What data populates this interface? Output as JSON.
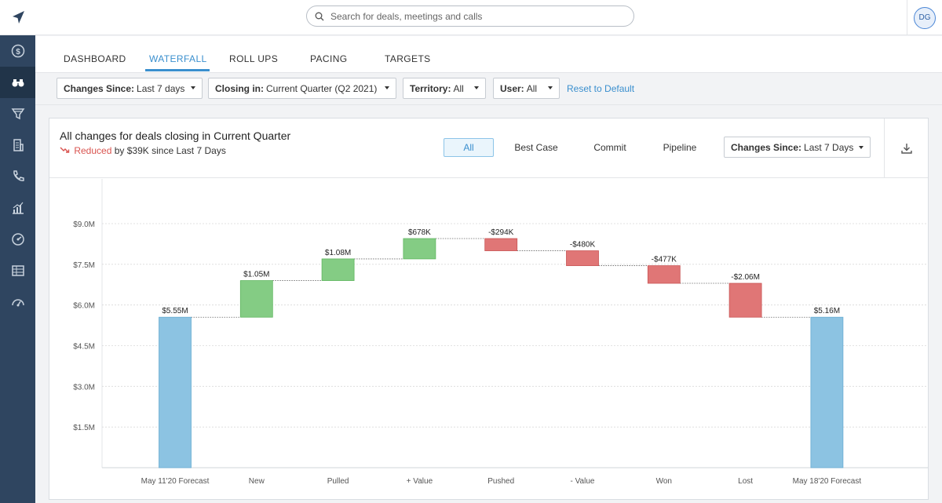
{
  "search": {
    "placeholder": "Search for deals, meetings and calls"
  },
  "user": {
    "initials": "DG"
  },
  "sidebar": {
    "items": [
      {
        "icon": "dollar-icon"
      },
      {
        "icon": "binoculars-icon",
        "active": true
      },
      {
        "icon": "funnel-icon"
      },
      {
        "icon": "building-icon"
      },
      {
        "icon": "phone-icon"
      },
      {
        "icon": "bar-chart-icon"
      },
      {
        "icon": "gauge-refresh-icon"
      },
      {
        "icon": "table-icon"
      },
      {
        "icon": "speedometer-icon"
      }
    ]
  },
  "tabs": [
    {
      "label": "DASHBOARD"
    },
    {
      "label": "WATERFALL",
      "active": true
    },
    {
      "label": "ROLL UPS"
    },
    {
      "label": "PACING"
    },
    {
      "label": "TARGETS"
    }
  ],
  "filters": {
    "changes_since": {
      "label": "Changes Since:",
      "value": "Last 7 days"
    },
    "closing_in": {
      "label": "Closing in:",
      "value": "Current Quarter (Q2 2021)"
    },
    "territory": {
      "label": "Territory:",
      "value": "All"
    },
    "user": {
      "label": "User:",
      "value": "All"
    },
    "reset": "Reset to Default"
  },
  "card": {
    "title": "All changes for deals closing in Current Quarter",
    "sub_change": "Reduced",
    "sub_rest": "by $39K since Last 7 Days",
    "segments": [
      "All",
      "Best Case",
      "Commit",
      "Pipeline"
    ],
    "active_segment": "All",
    "filter_label": "Changes Since:",
    "filter_value": "Last 7 Days"
  },
  "colors": {
    "total": "#8cc3e2",
    "increase": "#84cc84",
    "decrease": "#e07676",
    "accent": "#3a8fce",
    "sidebar": "#2f4560"
  },
  "chart_data": {
    "type": "bar",
    "subtype": "waterfall",
    "ylim": [
      0,
      9000000
    ],
    "yticks": [
      {
        "value": 1500000,
        "label": "$1.5M"
      },
      {
        "value": 3000000,
        "label": "$3.0M"
      },
      {
        "value": 4500000,
        "label": "$4.5M"
      },
      {
        "value": 6000000,
        "label": "$6.0M"
      },
      {
        "value": 7500000,
        "label": "$7.5M"
      },
      {
        "value": 9000000,
        "label": "$9.0M"
      }
    ],
    "grid": true,
    "bars": [
      {
        "category": "May 11'20 Forecast",
        "kind": "total",
        "start": 0,
        "end": 5550000,
        "label": "$5.55M"
      },
      {
        "category": "New",
        "kind": "increase",
        "start": 5550000,
        "end": 6900000,
        "label": "$1.05M"
      },
      {
        "category": "Pulled",
        "kind": "increase",
        "start": 6900000,
        "end": 7700000,
        "label": "$1.08M"
      },
      {
        "category": "+ Value",
        "kind": "increase",
        "start": 7700000,
        "end": 8450000,
        "label": "$678K"
      },
      {
        "category": "Pushed",
        "kind": "decrease",
        "start": 8450000,
        "end": 8000000,
        "label": "-$294K"
      },
      {
        "category": "- Value",
        "kind": "decrease",
        "start": 8000000,
        "end": 7450000,
        "label": "-$480K"
      },
      {
        "category": "Won",
        "kind": "decrease",
        "start": 7450000,
        "end": 6800000,
        "label": "-$477K"
      },
      {
        "category": "Lost",
        "kind": "decrease",
        "start": 6800000,
        "end": 5550000,
        "label": "-$2.06M"
      },
      {
        "category": "May 18'20 Forecast",
        "kind": "total",
        "start": 0,
        "end": 5550000,
        "label": "$5.16M"
      }
    ]
  }
}
